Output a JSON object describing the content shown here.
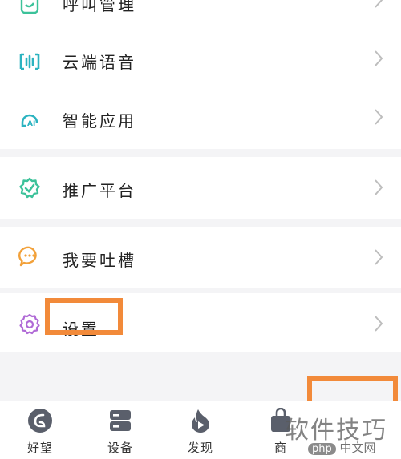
{
  "menu": [
    {
      "label": "呼叫管理",
      "icon": "call-management-icon"
    },
    {
      "label": "云端语音",
      "icon": "cloud-voice-icon"
    },
    {
      "label": "智能应用",
      "icon": "smart-app-icon"
    },
    {
      "label": "推广平台",
      "icon": "promotion-platform-icon"
    },
    {
      "label": "我要吐槽",
      "icon": "feedback-chat-icon"
    },
    {
      "label": "设置",
      "icon": "settings-gear-icon"
    }
  ],
  "tabs": [
    {
      "label": "好望",
      "icon": "haowang-logo-icon"
    },
    {
      "label": "设备",
      "icon": "device-icon"
    },
    {
      "label": "发现",
      "icon": "discover-icon"
    },
    {
      "label": "商",
      "icon": "store-icon"
    }
  ],
  "watermark": {
    "text": "软件技巧",
    "badge": "php",
    "site": "中文网"
  },
  "colors": {
    "highlight": "#f28a3a",
    "green": "#3cc29a",
    "teal": "#2bb3c0",
    "orange": "#f2a13a",
    "purple": "#b06ad6",
    "tab_icon": "#5a5f6b"
  }
}
